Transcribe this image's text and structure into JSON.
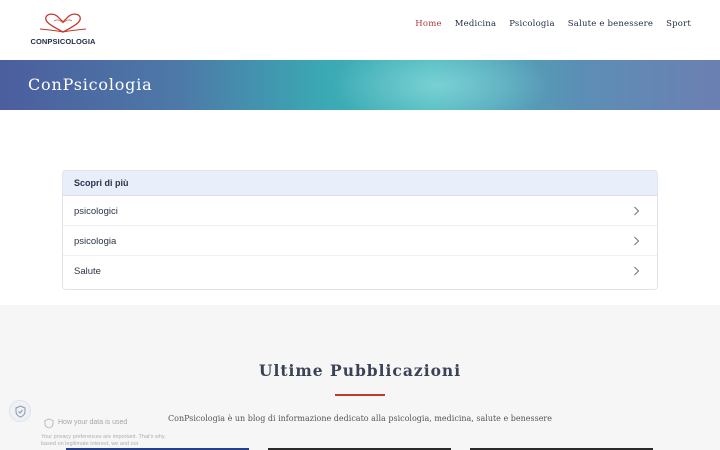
{
  "header": {
    "logo_text": "CONPSICOLOGIA",
    "nav": [
      {
        "label": "Home",
        "active": true
      },
      {
        "label": "Medicina",
        "active": false
      },
      {
        "label": "Psicologia",
        "active": false
      },
      {
        "label": "Salute e benessere",
        "active": false
      },
      {
        "label": "Sport",
        "active": false
      }
    ],
    "accent_color": "#b33a3a"
  },
  "hero": {
    "title": "ConPsicologia"
  },
  "discover": {
    "heading": "Scopri di più",
    "items": [
      "psicologici",
      "psicologia",
      "Salute"
    ],
    "chevron_icon": "chevron-right-icon"
  },
  "publications": {
    "title": "Ultime Pubblicazioni",
    "description": "ConPsicologia è un blog di informazione dedicato alla psicologia, medicina, salute e benessere",
    "underline_color": "#c0392b"
  },
  "privacy": {
    "title": "How your data is used",
    "text": "Your privacy preferences are important. That's why, based on legitimate interest, we and our"
  }
}
